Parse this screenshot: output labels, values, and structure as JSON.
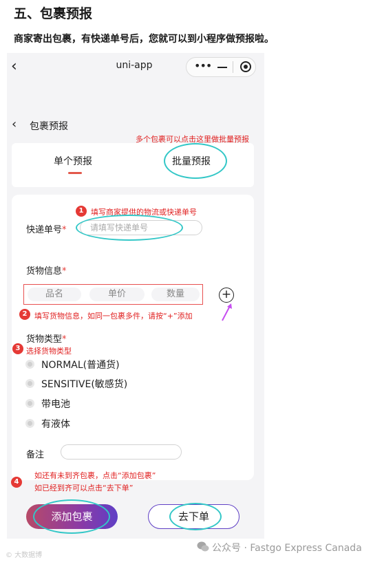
{
  "article": {
    "section_title": "五、包裹预报",
    "description": "商家寄出包裹，有快递单号后，您就可以到小程序做预报啦。"
  },
  "miniapp": {
    "nav_title": "uni-app",
    "capsule_dots": "•••",
    "page_title": "包裹预报"
  },
  "tabs": {
    "single": "单个预报",
    "batch": "批量预报"
  },
  "form": {
    "tracking_label": "快递单号",
    "required_mark": "*",
    "tracking_placeholder": "请填写快递单号",
    "goods_label": "货物信息",
    "goods_name_placeholder": "品名",
    "goods_price_placeholder": "单价",
    "goods_qty_placeholder": "数量",
    "add_goods": "+",
    "type_label": "货物类型",
    "type_options": [
      "NORMAL(普通货)",
      "SENSITIVE(敏感货)",
      "带电池",
      "有液体"
    ],
    "remark_label": "备注"
  },
  "annotations": {
    "batch_hint": "多个包裹可以点击这里做批量预报",
    "step1_num": "1",
    "step1": "填写商家提供的物流或快递单号",
    "step2_num": "2",
    "step2": "填写货物信息，如同一包裹多件，请按“+”添加",
    "step3_num": "3",
    "step3": "选择货物类型",
    "step4_num": "4",
    "step4_line1": "如还有未到齐包裹，点击“添加包裹”",
    "step4_line2": "如已经到齐可以点击“去下单”"
  },
  "buttons": {
    "add_package": "添加包裹",
    "place_order": "去下单"
  },
  "watermark": {
    "left": "© 大数据博",
    "right": "公众号 · Fastgo Express Canada"
  },
  "colors": {
    "annotation_red": "#e02020",
    "highlight_cyan": "#33c7c7",
    "accent_purple": "#5f3fc5"
  }
}
